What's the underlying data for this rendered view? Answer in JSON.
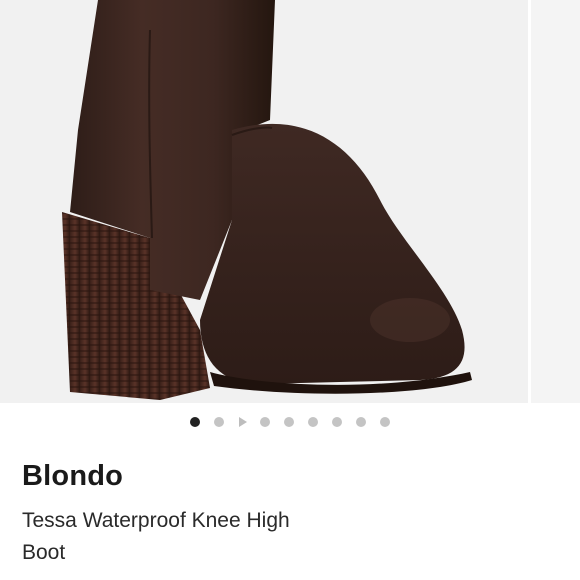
{
  "product": {
    "brand": "Blondo",
    "name": "Tessa Waterproof Knee High Boot",
    "image_alt": "Dark brown suede knee high boot with stacked block heel"
  },
  "gallery": {
    "total_slides": 9,
    "active_index": 0,
    "video_slide_index": 2
  },
  "colors": {
    "suede": "#3a2620",
    "heel": "#4a2a22",
    "background": "#f1f1f1",
    "active_dot": "#222222",
    "inactive_dot": "#c4c4c4"
  }
}
